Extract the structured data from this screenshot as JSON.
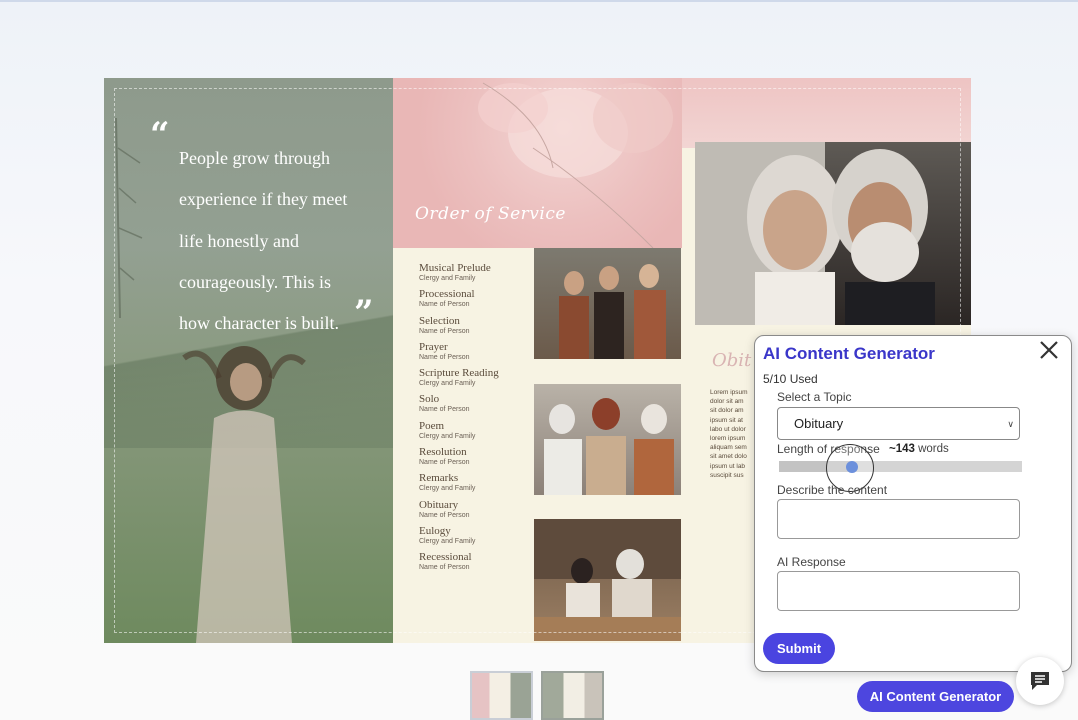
{
  "brochure": {
    "quote": {
      "open_mark": "“",
      "lines": [
        "People grow through",
        "experience if they meet",
        "life honestly and",
        "courageously. This is",
        "how character is built."
      ],
      "close_mark": "”"
    },
    "order_title": "Order of Service",
    "service_items": [
      {
        "title": "Musical Prelude",
        "sub": "Clergy and Family"
      },
      {
        "title": "Processional",
        "sub": "Name of Person"
      },
      {
        "title": "Selection",
        "sub": "Name of Person"
      },
      {
        "title": "Prayer",
        "sub": "Name of Person"
      },
      {
        "title": "Scripture Reading",
        "sub": "Clergy and Family"
      },
      {
        "title": "Solo",
        "sub": "Name of Person"
      },
      {
        "title": "Poem",
        "sub": "Clergy and Family"
      },
      {
        "title": "Resolution",
        "sub": "Name of Person"
      },
      {
        "title": "Remarks",
        "sub": "Clergy and Family"
      },
      {
        "title": "Obituary",
        "sub": "Name of Person"
      },
      {
        "title": "Eulogy",
        "sub": "Clergy and Family"
      },
      {
        "title": "Recessional",
        "sub": "Name of Person"
      }
    ],
    "obit_title": "Obit",
    "lorem_lines": [
      "Lorem ipsum",
      "dolor sit am",
      "sit dolor am",
      "ipsum sit at",
      "labo ut dolor",
      "lorem ipsum",
      "aliquam sem",
      "sit amet dolo",
      "ipsum ut lab",
      "suscipit sus"
    ]
  },
  "ai_panel": {
    "title": "AI Content Generator",
    "usage": "5/10 Used",
    "topic_label": "Select a Topic",
    "topic_value": "Obituary",
    "length_label": "Length of response",
    "words_value": "~143",
    "words_unit": "words",
    "length_fraction": 0.3,
    "describe_label": "Describe the content",
    "response_label": "AI Response",
    "submit_label": "Submit"
  },
  "footer": {
    "generator_button": "AI Content Generator"
  },
  "colors": {
    "accent": "#4a44e0",
    "title": "#3a36c9",
    "pink": "#e9b7b6",
    "cream": "#f7f3e3",
    "sage": "#8e9a8c"
  },
  "icons": {
    "close": "close-icon",
    "chat": "chat-bubble-icon",
    "quote": "quote-icon"
  }
}
